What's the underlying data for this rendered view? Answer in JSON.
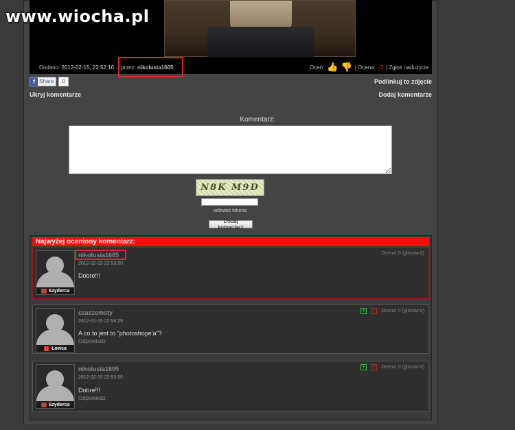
{
  "site": {
    "logo": "www.wiocha.pl"
  },
  "photo": {
    "added_label": "Dodano:",
    "added_date": "2012-02-15, 22:52:16",
    "by_label": "przez:",
    "author": "nikolusia1605",
    "rate_label": "Oceń:",
    "score_label": "| Ocena:",
    "score_value": "-3",
    "report": "| Zgłoś nadużycie"
  },
  "share": {
    "label": "Share",
    "count": "0"
  },
  "links": {
    "link_to_photo": "Podlinkuj to zdjęcie",
    "hide_comments": "Ukryj komentarze",
    "add_comment": "Dodaj komentarze"
  },
  "form": {
    "comment_label": "Komentarz:",
    "captcha_text": "N8K M9D",
    "refresh_token": "odśwież tokena",
    "submit": "Dodaj komentarz"
  },
  "top_comment": {
    "header": "Najwyżej oceniony komentarz:",
    "user": "nikolusia1605",
    "date": "2012-02-15 22:53:50",
    "text": "Dobre!!!",
    "rating": "Ocena: 0 (glosow:0)",
    "rank": "Szyderca"
  },
  "comments": [
    {
      "user": "czaszemsty",
      "date": "2012-02-15 22:54:28",
      "text": "A co to jest to \"photoshope'a\"?",
      "reply": "Odpowiedz",
      "rating": "Ocena: 0 (glosow:0)",
      "rank": "Łowca"
    },
    {
      "user": "nikolusia1605",
      "date": "2012-02-15 22:53:50",
      "text": "Dobre!!!",
      "reply": "Odpowiedz",
      "rating": "Ocena: 0 (glosow:0)",
      "rank": "Szyderca"
    }
  ],
  "colors": {
    "highlight": "#e0242e",
    "header_red": "#ff0a0a",
    "score_red": "#ff3b3b"
  }
}
